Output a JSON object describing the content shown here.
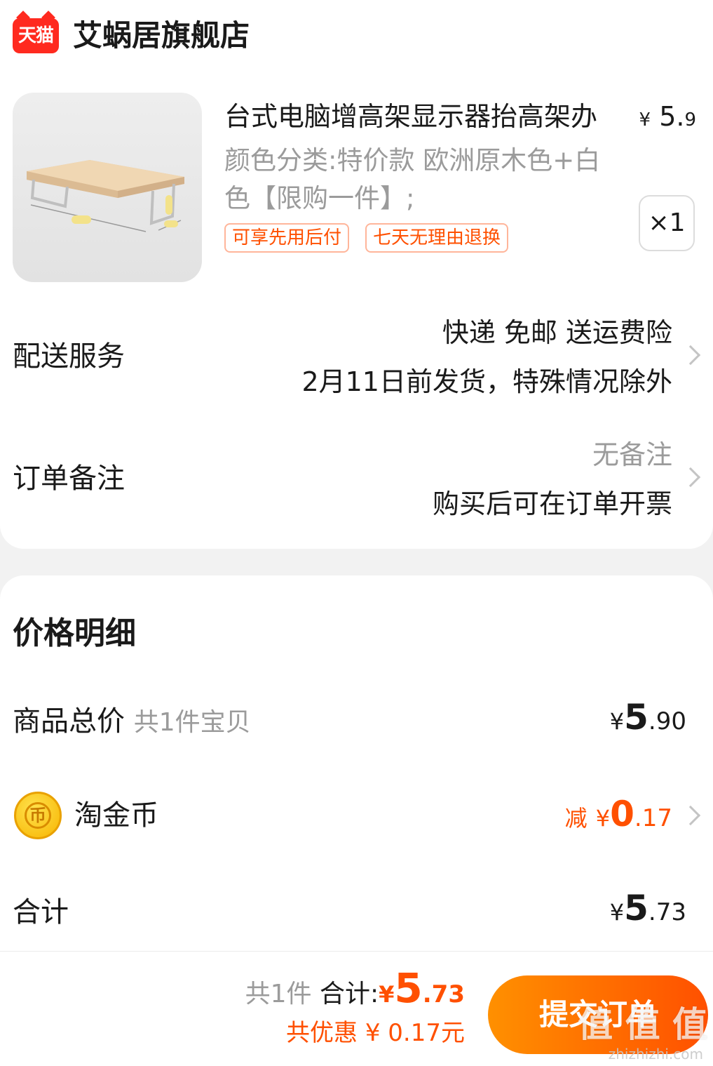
{
  "store": {
    "logo_text": "天猫",
    "name": "艾蜗居旗舰店"
  },
  "product": {
    "title": "台式电脑增高架显示器抬高架办",
    "price_yen": "¥",
    "price_int": "5.",
    "price_dec": "9",
    "sku_line1": "颜色分类:特价款 欧洲原木色+白",
    "sku_line2": "色【限购一件】;",
    "quantity": "×1",
    "tags": [
      "可享先用后付",
      "七天无理由退换"
    ]
  },
  "delivery": {
    "label": "配送服务",
    "line1": "快递 免邮 送运费险",
    "line2": "2月11日前发货，特殊情况除外"
  },
  "note": {
    "label": "订单备注",
    "line1": "无备注",
    "line2": "购买后可在订单开票"
  },
  "price_detail": {
    "title": "价格明细",
    "subtotal": {
      "label": "商品总价",
      "sub": "共1件宝贝",
      "yen": "¥",
      "int": "5",
      "dec": ".90"
    },
    "coins": {
      "label": "淘金币",
      "icon_text": "币",
      "prefix": "减",
      "yen": "¥",
      "int": "0",
      "dec": ".17"
    },
    "total": {
      "label": "合计",
      "yen": "¥",
      "int": "5",
      "dec": ".73"
    }
  },
  "bottom": {
    "count": "共1件",
    "total_label": "合计:",
    "yen": "¥",
    "int": "5",
    "dec": ".73",
    "discount": "共优惠 ¥ 0.17元",
    "submit": "提交订单",
    "watermark": "值 值 值",
    "watermark_url": "zhizhizhi.com"
  },
  "colors": {
    "accent": "#ff5000",
    "brand_red": "#ff2a1f",
    "muted": "#9b9b9b"
  }
}
